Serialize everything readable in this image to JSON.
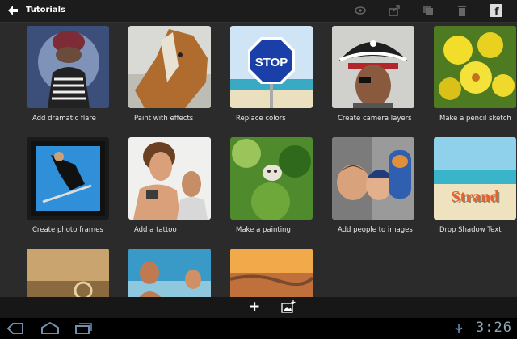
{
  "header": {
    "title": "Tutorials",
    "icons": [
      "back-arrow-icon",
      "link-icon",
      "share-icon",
      "copy-icon",
      "trash-icon",
      "facebook-icon"
    ]
  },
  "tutorials": [
    {
      "label": "Add dramatic flare"
    },
    {
      "label": "Paint with effects"
    },
    {
      "label": "Replace colors",
      "sign": "STOP"
    },
    {
      "label": "Create camera layers"
    },
    {
      "label": "Make a pencil sketch"
    },
    {
      "label": "Create photo frames"
    },
    {
      "label": "Add a tattoo"
    },
    {
      "label": "Make a painting"
    },
    {
      "label": "Add people to images"
    },
    {
      "label": "Drop Shadow Text",
      "text": "Strand"
    },
    {
      "label": ""
    },
    {
      "label": ""
    },
    {
      "label": ""
    }
  ],
  "bottombar": {
    "add_label": "+",
    "icons": [
      "add-icon",
      "add-image-icon"
    ]
  },
  "system": {
    "time": "3:26",
    "icons": [
      "back-nav-icon",
      "home-nav-icon",
      "recent-apps-icon",
      "usb-icon"
    ]
  }
}
